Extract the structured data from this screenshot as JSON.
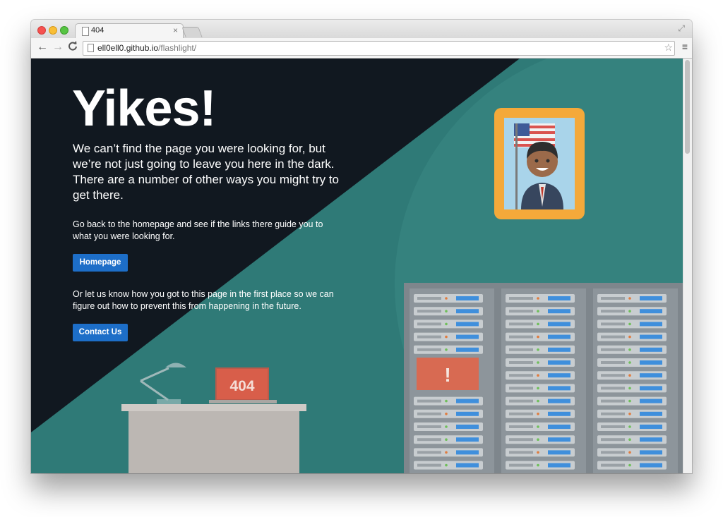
{
  "browser": {
    "tab_title": "404",
    "tab_close": "×",
    "url_host": "ell0ell0.github.io",
    "url_path": "/flashlight/",
    "back_glyph": "←",
    "forward_glyph": "→",
    "reload_glyph": "C",
    "star_glyph": "☆",
    "menu_glyph": "≡",
    "expand_glyph": "⤢"
  },
  "page": {
    "headline": "Yikes!",
    "lead": "We can’t find the page you were looking for, but we’re not just going to leave you here in the dark. There are a number of other ways you might try to get there.",
    "homepage_text": "Go back to the homepage and see if the links there guide you to what you were looking for.",
    "homepage_button": "Homepage",
    "contact_text": "Or let us know how you got to this page in the first place so we can figure out how to prevent this from happening in the future.",
    "contact_button": "Contact Us",
    "laptop_label": "404",
    "alert_glyph": "!"
  },
  "icons": [
    "close-icon",
    "back-icon",
    "forward-icon",
    "reload-icon",
    "page-icon",
    "star-icon",
    "menu-icon",
    "expand-icon"
  ],
  "colors": {
    "dark_bg": "#111820",
    "teal": "#2f7a77",
    "button_blue": "#1d6ec8",
    "laptop_red": "#d85e4a",
    "frame_gold": "#f4a93a"
  }
}
